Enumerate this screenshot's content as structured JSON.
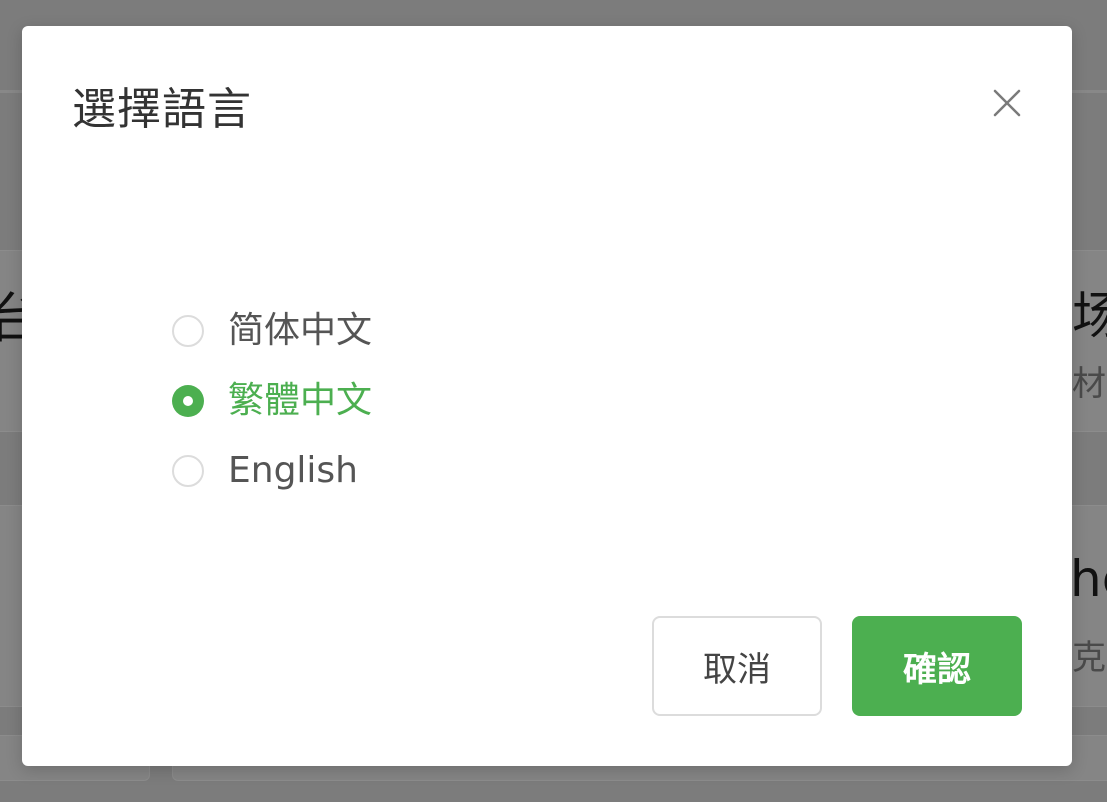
{
  "dialog": {
    "title": "選擇語言",
    "close_icon": "close-icon",
    "options": [
      {
        "label": "简体中文",
        "checked": false
      },
      {
        "label": "繁體中文",
        "checked": true
      },
      {
        "label": "English",
        "checked": false
      }
    ],
    "cancel_label": "取消",
    "confirm_label": "確認"
  },
  "background": {
    "left_fragment": "台",
    "right_fragments": [
      "场",
      "材",
      "he",
      "克"
    ]
  },
  "colors": {
    "accent": "#4caf50",
    "overlay": "#7c7c7c",
    "title_text": "#333333",
    "label_text": "#555555",
    "radio_border": "#dcdcdc"
  }
}
